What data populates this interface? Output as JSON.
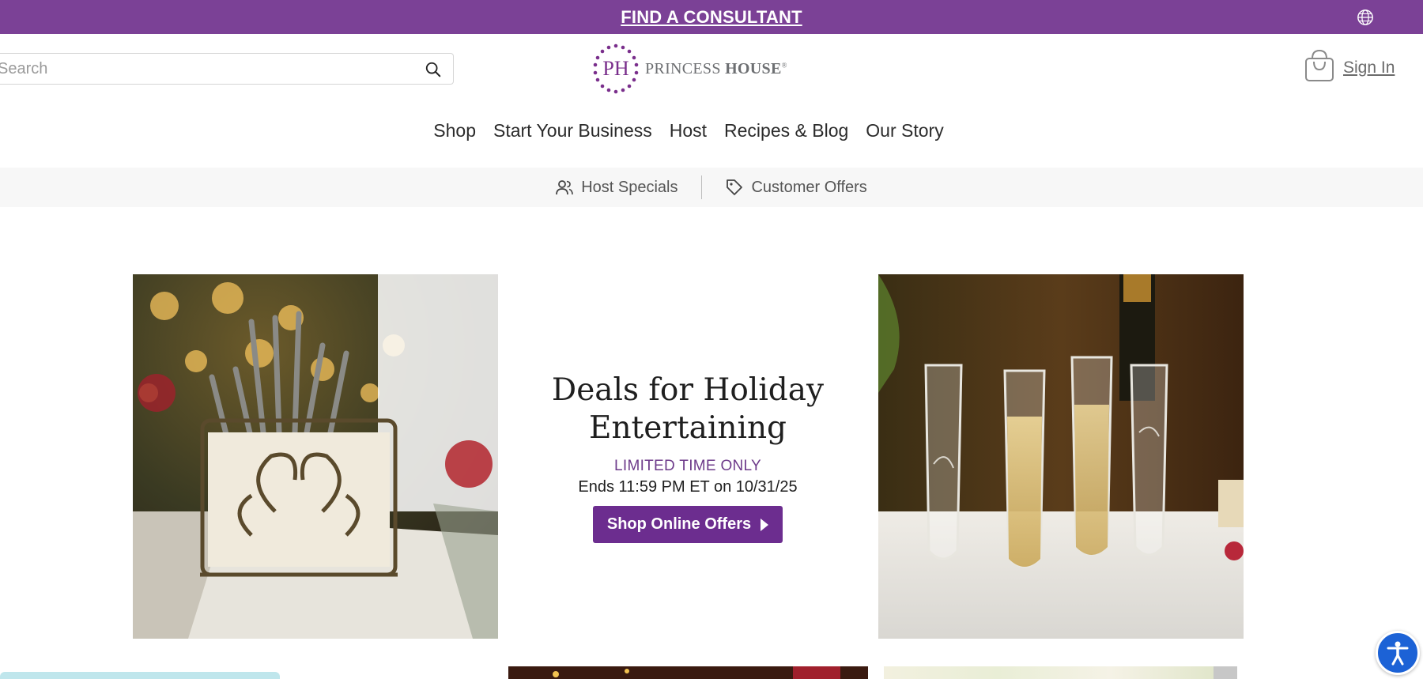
{
  "topbar": {
    "consultant_label": "FIND A CONSULTANT",
    "globe_icon": "globe-icon"
  },
  "header": {
    "search": {
      "placeholder": "Search",
      "value": "",
      "icon": "search-icon"
    },
    "logo": {
      "monogram": "PH",
      "brand_light": "PRINCESS ",
      "brand_bold": "HOUSE",
      "trademark": "®"
    },
    "cart_icon": "shopping-bag-icon",
    "signin_label": "Sign In"
  },
  "mainnav": {
    "items": [
      "Shop",
      "Start Your Business",
      "Host",
      "Recipes & Blog",
      "Our Story"
    ]
  },
  "subnav": {
    "host_specials": {
      "label": "Host Specials",
      "icon": "people-icon"
    },
    "customer_offers": {
      "label": "Customer Offers",
      "icon": "tag-icon"
    }
  },
  "promo": {
    "title_line1": "Deals for Holiday",
    "title_line2": "Entertaining",
    "limited": "LIMITED TIME ONLY",
    "ends": "Ends 11:59 PM ET on 10/31/25",
    "button_label": "Shop Online Offers"
  },
  "colors": {
    "brand_purple": "#7b4196",
    "button_purple": "#6c2d8f",
    "accessibility_blue": "#1c62d6"
  },
  "accessibility_icon": "accessibility-icon"
}
